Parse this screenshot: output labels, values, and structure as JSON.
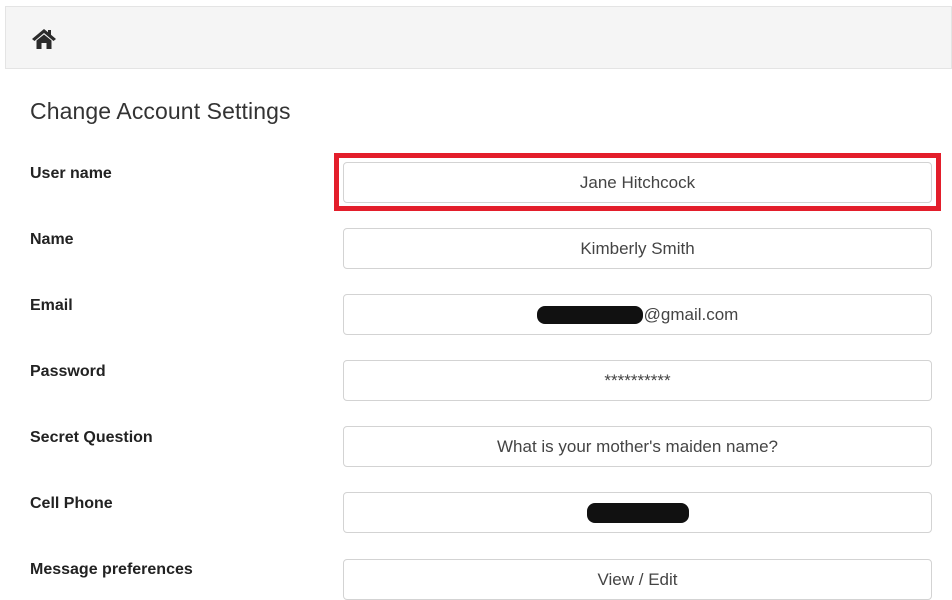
{
  "header": {
    "home_icon": "home-icon"
  },
  "page": {
    "title": "Change Account Settings"
  },
  "fields": {
    "username": {
      "label": "User name",
      "value": "Jane Hitchcock"
    },
    "name": {
      "label": "Name",
      "value": "Kimberly Smith"
    },
    "email": {
      "label": "Email",
      "value_suffix": "@gmail.com"
    },
    "password": {
      "label": "Password",
      "value": "**********"
    },
    "secret_question": {
      "label": "Secret Question",
      "value": "What is your mother's maiden name?"
    },
    "cell_phone": {
      "label": "Cell Phone"
    },
    "message_preferences": {
      "label": "Message preferences",
      "button": "View / Edit"
    }
  },
  "colors": {
    "highlight": "#e31e2b",
    "topbar": "#f5f5f5"
  }
}
